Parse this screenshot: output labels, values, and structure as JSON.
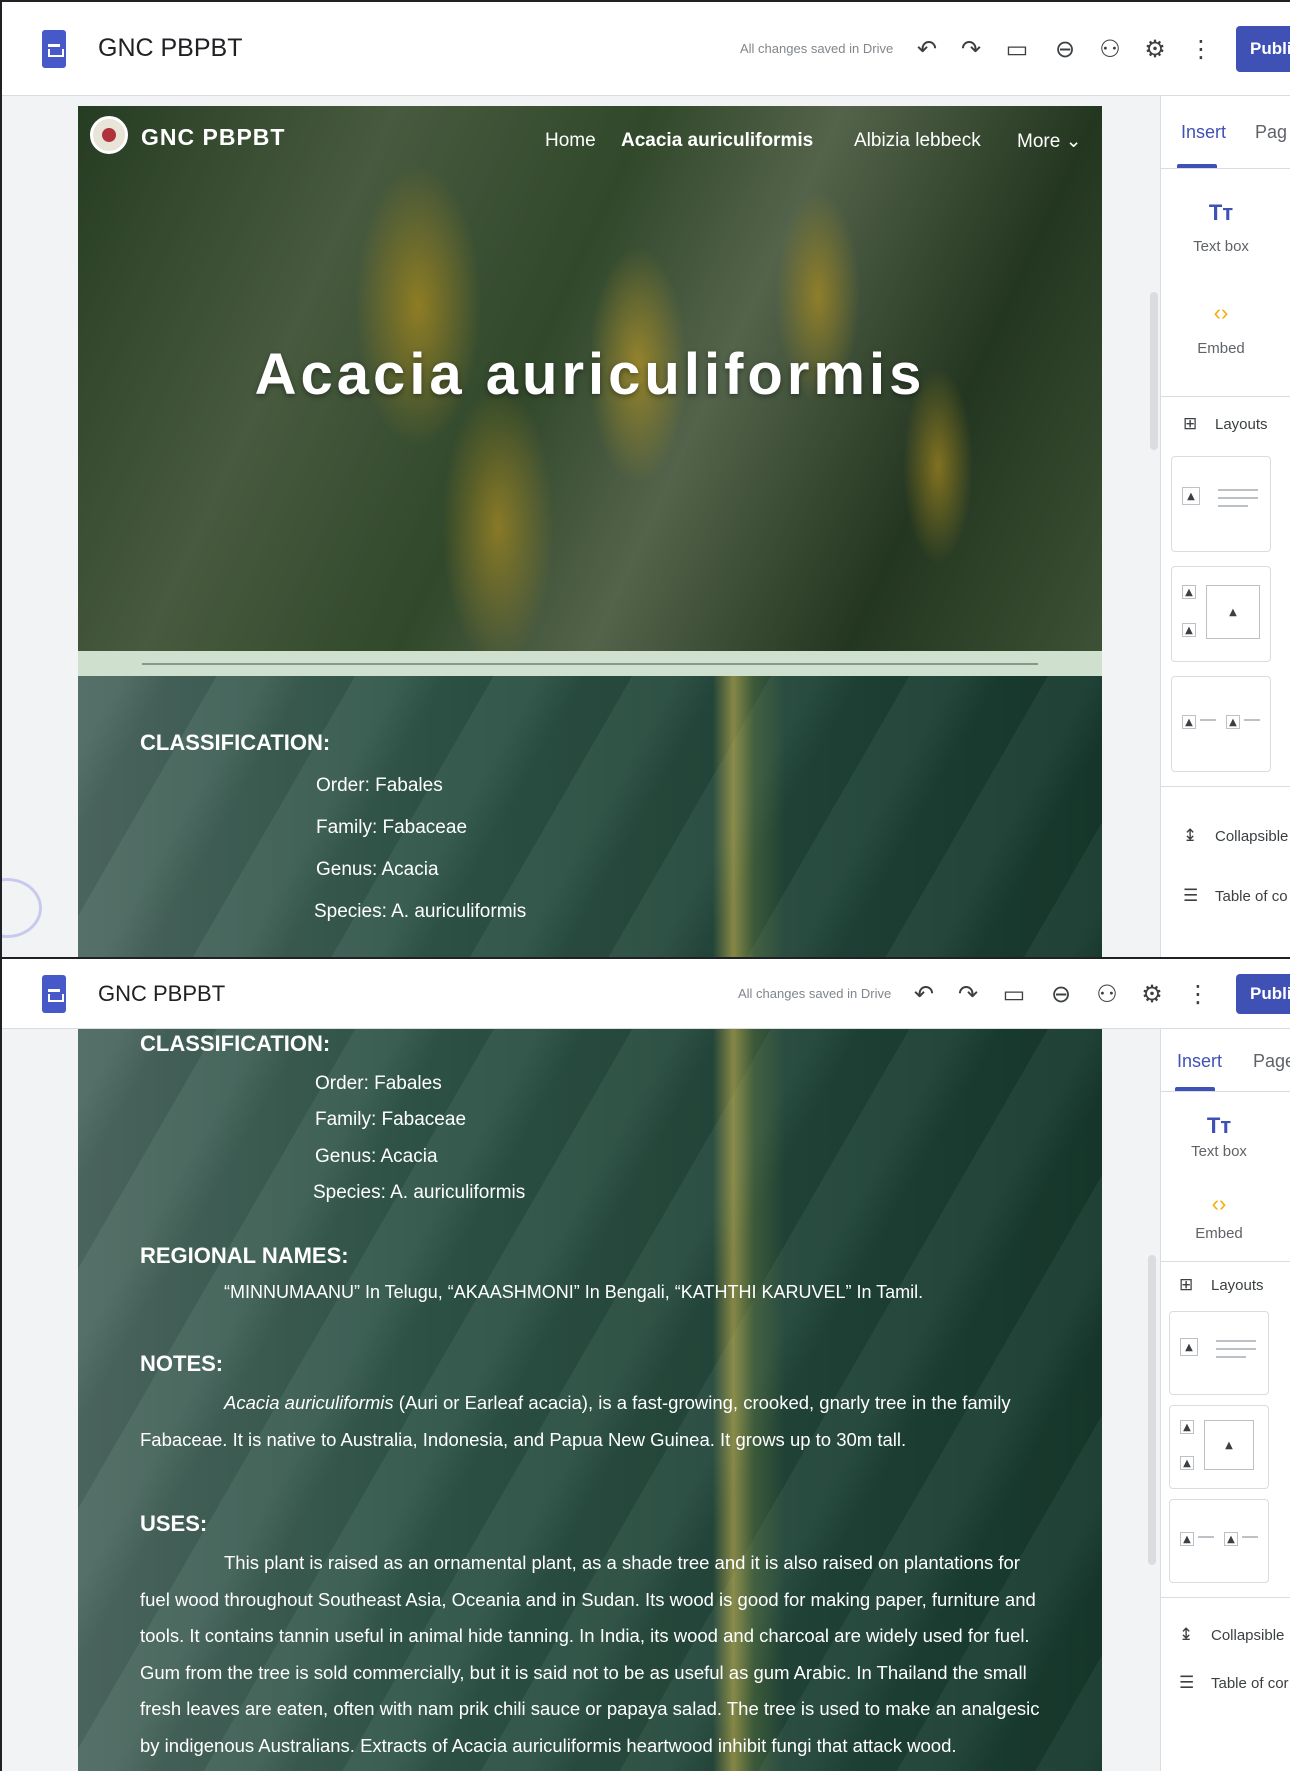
{
  "app": {
    "doc_title": "GNC PBPBT",
    "save_status": "All changes saved in Drive",
    "publish_label": "Publish",
    "toolbar_icons": [
      "undo-icon",
      "redo-icon",
      "preview-icon",
      "link-icon",
      "share-icon",
      "settings-icon",
      "more-vert-icon"
    ]
  },
  "site": {
    "name": "GNC PBPBT",
    "nav": [
      "Home",
      "Acacia auriculiformis",
      "Albizia lebbeck",
      "More ⌄"
    ],
    "active_nav": "Acacia auriculiformis",
    "page_title": "Acacia auriculiformis"
  },
  "content": {
    "classification": {
      "heading": "CLASSIFICATION:",
      "order": "Order: Fabales",
      "family": "Family: Fabaceae",
      "genus": "Genus:  Acacia",
      "species": "Species: A. auriculiformis"
    },
    "regional": {
      "heading": "REGIONAL NAMES:",
      "text": "“MINNUMAANU” In Telugu, “AKAASHMONI” In Bengali, “KATHTHI KARUVEL” In Tamil."
    },
    "notes": {
      "heading": "NOTES:",
      "italic": "Acacia auriculiformis",
      "text": " (Auri or Earleaf acacia), is a fast-growing, crooked, gnarly tree in the family Fabaceae. It is native to Australia, Indonesia, and Papua New Guinea. It grows up to 30m tall."
    },
    "uses": {
      "heading": "USES:",
      "text": "This plant is raised as an ornamental plant, as a shade tree and it is also raised on plantations for fuel wood throughout Southeast Asia, Oceania and in Sudan. Its wood is good for making paper, furniture and tools. It contains tannin useful in animal hide tanning. In India, its wood and charcoal are widely used for fuel. Gum from the tree is sold commercially, but it is said not to be as useful as gum Arabic. In Thailand the small fresh leaves are eaten, often with nam prik chili sauce or papaya salad. The tree is used to make an analgesic by indigenous Australians. Extracts of Acacia auriculiformis heartwood inhibit fungi that attack wood."
    }
  },
  "panel": {
    "tabs": [
      "Insert",
      "Pages"
    ],
    "shot1_tabs": [
      "Insert",
      "Pag"
    ],
    "shot2_tabs": [
      "Insert",
      "Page"
    ],
    "text_box": "Text box",
    "embed": "Embed",
    "layouts": "Layouts",
    "collapsible": "Collapsible",
    "collapsible_s2": "Collapsible",
    "toc": "Table of co",
    "toc_s2": "Table of cor"
  }
}
